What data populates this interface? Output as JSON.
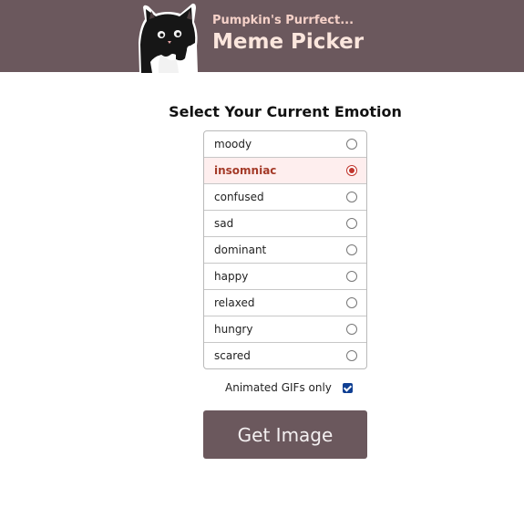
{
  "header": {
    "subtitle": "Pumpkin's Purrfect...",
    "title": "Meme Picker",
    "logo_icon": "tuxedo-cat-icon",
    "background_color": "#6b585d"
  },
  "main": {
    "heading": "Select Your Current Emotion",
    "emotions": [
      {
        "label": "moody",
        "selected": false
      },
      {
        "label": "insomniac",
        "selected": true
      },
      {
        "label": "confused",
        "selected": false
      },
      {
        "label": "sad",
        "selected": false
      },
      {
        "label": "dominant",
        "selected": false
      },
      {
        "label": "happy",
        "selected": false
      },
      {
        "label": "relaxed",
        "selected": false
      },
      {
        "label": "hungry",
        "selected": false
      },
      {
        "label": "scared",
        "selected": false
      }
    ],
    "gifs_only_label": "Animated GIFs only",
    "gifs_only_checked": true,
    "get_image_label": "Get Image"
  },
  "colors": {
    "accent": "#6b585d",
    "selected_text": "#a43a28",
    "selected_bg": "#feeeee"
  }
}
